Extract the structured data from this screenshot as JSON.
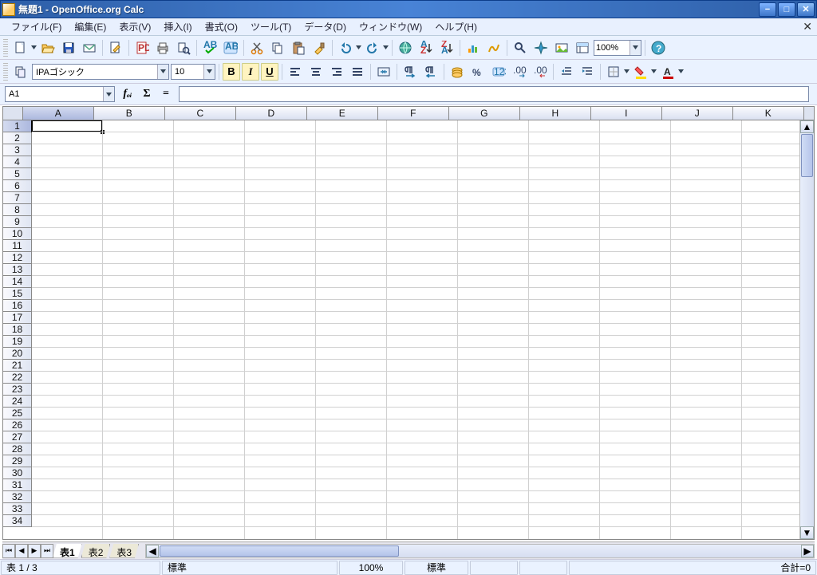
{
  "title": "無題1 - OpenOffice.org Calc",
  "menu": {
    "file": "ファイル(F)",
    "edit": "編集(E)",
    "view": "表示(V)",
    "insert": "挿入(I)",
    "format": "書式(O)",
    "tools": "ツール(T)",
    "data": "データ(D)",
    "window": "ウィンドウ(W)",
    "help": "ヘルプ(H)"
  },
  "zoom": "100%",
  "font": {
    "name": "IPAゴシック",
    "size": "10"
  },
  "cellref": "A1",
  "columns": [
    "A",
    "B",
    "C",
    "D",
    "E",
    "F",
    "G",
    "H",
    "I",
    "J",
    "K"
  ],
  "rows": 34,
  "tabs": {
    "s1": "表1",
    "s2": "表2",
    "s3": "表3"
  },
  "status": {
    "sheet": "表 1 / 3",
    "style": "標準",
    "zoom": "100%",
    "mode": "標準",
    "sum": "合計=0"
  }
}
